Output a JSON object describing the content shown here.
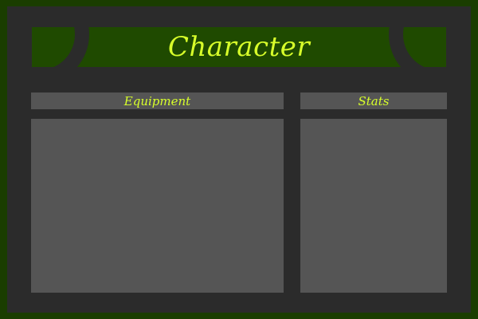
{
  "window": {
    "title": "Character"
  },
  "sections": {
    "equipment": {
      "label": "Equipment"
    },
    "stats": {
      "label": "Stats"
    }
  },
  "colors": {
    "background": "#1a3d00",
    "frame": "#2b2b2b",
    "title_bar": "#1f4a00",
    "panel": "#555555",
    "accent_text": "#d8ff2a"
  }
}
